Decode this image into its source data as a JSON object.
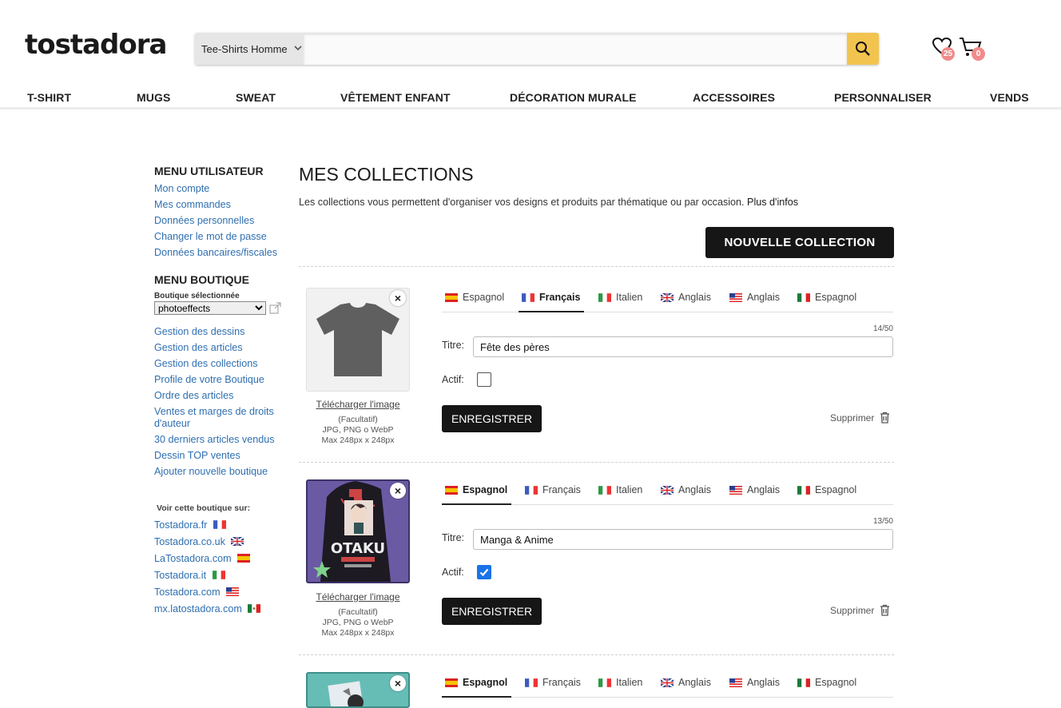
{
  "header": {
    "logo": "tostadora",
    "search_category": "Tee-Shirts Homme",
    "search_placeholder": "",
    "favorites_count": "25",
    "cart_count": "0"
  },
  "nav": [
    "T-SHIRT",
    "MUGS",
    "SWEAT",
    "VÊTEMENT ENFANT",
    "DÉCORATION MURALE",
    "ACCESSOIRES",
    "PERSONNALISER",
    "VENDS"
  ],
  "sidebar": {
    "user_menu_title": "MENU UTILISATEUR",
    "user_links": [
      "Mon compte",
      "Mes commandes",
      "Données personnelles",
      "Changer le mot de passe",
      "Données bancaires/fiscales"
    ],
    "shop_menu_title": "MENU BOUTIQUE",
    "shop_selected_label": "Boutique sélectionnée",
    "shop_selected_value": "photoeffects",
    "shop_links": [
      "Gestion des dessins",
      "Gestion des articles",
      "Gestion des collections",
      "Profile de votre Boutique",
      "Ordre des articles",
      "Ventes et marges de droits d'auteur",
      "30 derniers articles vendus",
      "Dessin TOP ventes",
      "Ajouter nouvelle boutique"
    ],
    "see_shop_title": "Voir cette boutique sur:",
    "see_shop_links": [
      "Tostadora.fr",
      "Tostadora.co.uk",
      "LaTostadora.com",
      "Tostadora.it",
      "Tostadora.com",
      "mx.latostadora.com"
    ]
  },
  "main": {
    "title": "MES COLLECTIONS",
    "intro": "Les collections vous permettent d'organiser vos designs et produits par thématique ou par occasion.",
    "more_info": "Plus d'infos",
    "new_collection_button": "NOUVELLE COLLECTION",
    "upload_link": "Télécharger l'image",
    "upload_optional": "(Facultatif)",
    "upload_formats": "JPG, PNG o WebP",
    "upload_max": "Max 248px x 248px",
    "title_label": "Titre:",
    "active_label": "Actif:",
    "save_button": "ENREGISTRER",
    "delete_label": "Supprimer",
    "remove_symbol": "×",
    "tab_labels": [
      "Espagnol",
      "Français",
      "Italien",
      "Anglais",
      "Anglais",
      "Espagnol"
    ],
    "collections": [
      {
        "title": "Fête des pères",
        "counter": "14/50",
        "active": false,
        "active_tab": 1
      },
      {
        "title": "Manga & Anime",
        "counter": "13/50",
        "active": true,
        "active_tab": 0
      },
      {
        "title": "",
        "counter": "",
        "active": false,
        "active_tab": 0
      }
    ]
  },
  "colors": {
    "link": "#2f6fb0",
    "button_dark": "#161616",
    "search_button": "#f2c44f",
    "badge": "#f08c8c",
    "checkbox_on": "#1a73e8"
  }
}
